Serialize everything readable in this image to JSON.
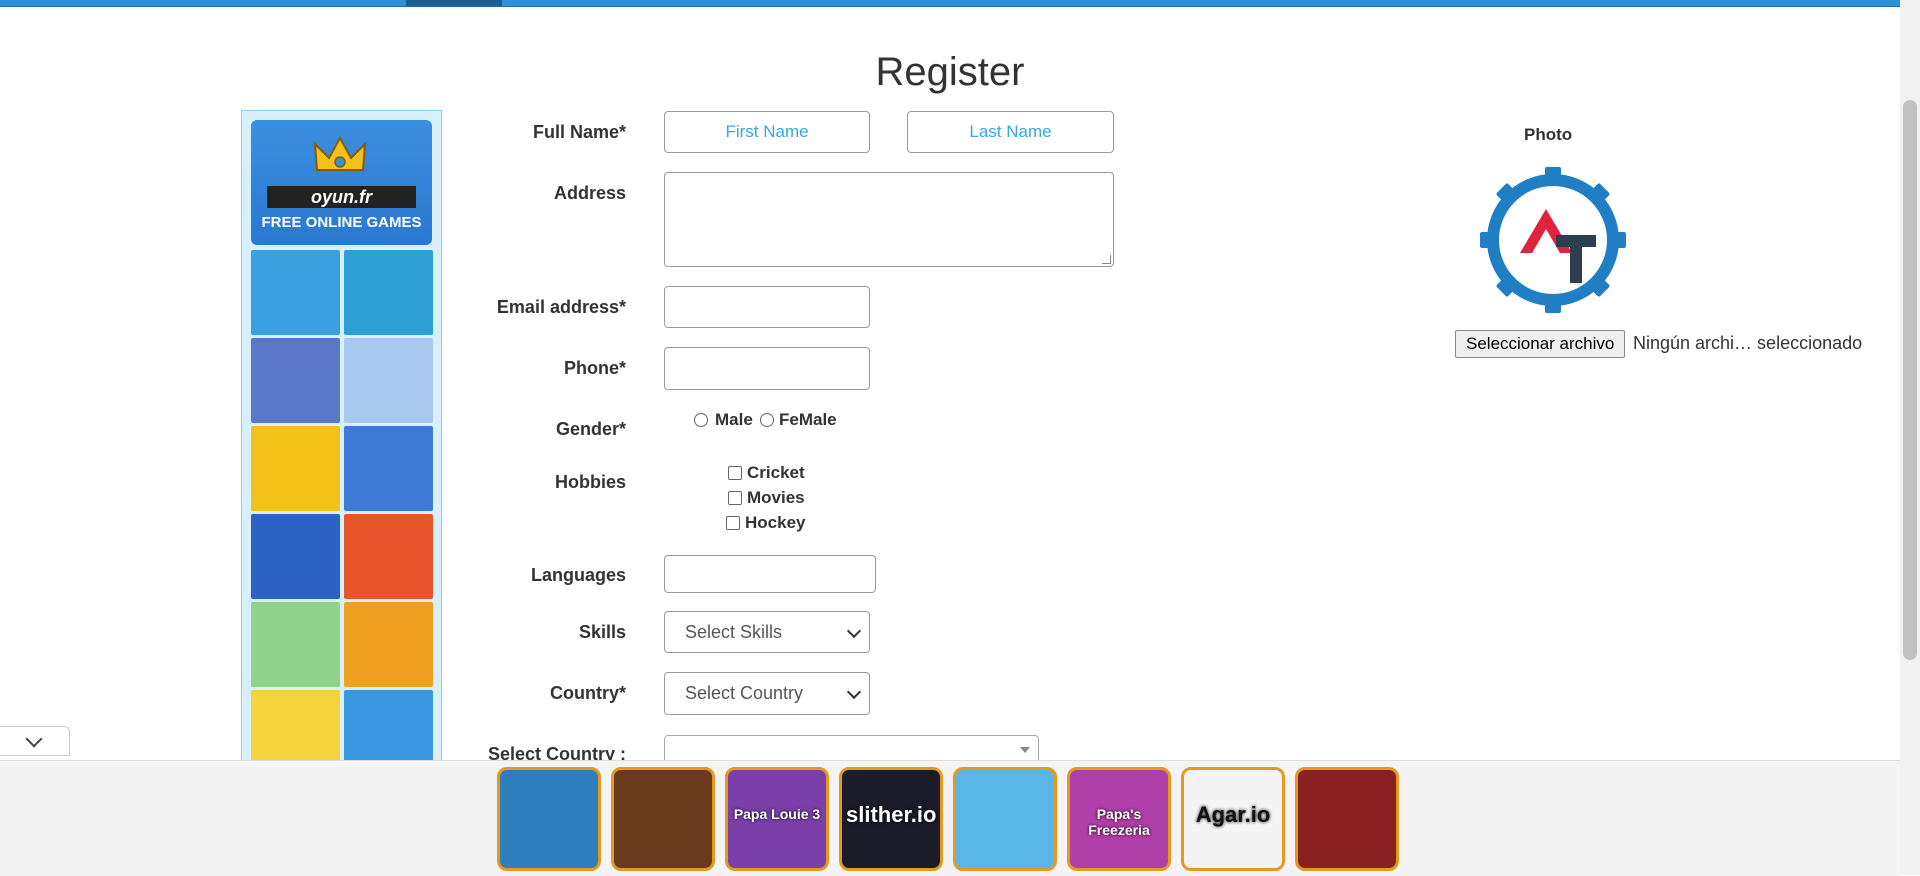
{
  "page": {
    "title": "Register"
  },
  "ad": {
    "brand": "oyun.fr",
    "tagline": "FREE ONLINE GAMES",
    "tiles": [
      {
        "name": "runners-game",
        "color": "#3aa0e0"
      },
      {
        "name": "shark-game",
        "color": "#2c9fd4"
      },
      {
        "name": "agent-game",
        "color": "#5a77c8"
      },
      {
        "name": "shooter-game",
        "color": "#a8c8f0"
      },
      {
        "name": "cuphead-game",
        "color": "#f2c21b"
      },
      {
        "name": "stickman-game",
        "color": "#3d7bd6"
      },
      {
        "name": "sonic-game",
        "color": "#2b62c4"
      },
      {
        "name": "fireboy-game",
        "color": "#e8552a"
      },
      {
        "name": "archer-game",
        "color": "#8fd48a"
      },
      {
        "name": "mario-game",
        "color": "#f0a020"
      },
      {
        "name": "spongebob-game",
        "color": "#f5d33b"
      },
      {
        "name": "stick-war-game",
        "color": "#3a98e0"
      }
    ]
  },
  "form": {
    "full_name_label": "Full Name*",
    "first_name_placeholder": "First Name",
    "last_name_placeholder": "Last Name",
    "address_label": "Address",
    "email_label": "Email address*",
    "phone_label": "Phone*",
    "gender_label": "Gender*",
    "gender_options": [
      "Male",
      "FeMale"
    ],
    "hobbies_label": "Hobbies",
    "hobbies": [
      "Cricket",
      "Movies",
      "Hockey"
    ],
    "languages_label": "Languages",
    "skills_label": "Skills",
    "skills_value": "Select Skills",
    "country_label": "Country*",
    "country_value": "Select Country",
    "select_country_label": "Select Country :"
  },
  "photo": {
    "label": "Photo",
    "file_button": "Seleccionar archivo",
    "file_status": "Ningún archi… seleccionado"
  },
  "colors": {
    "accent": "#2f8fd8",
    "placeholder": "#35a6e8",
    "logo_gear": "#1f7ec4",
    "logo_a": "#e0233d",
    "logo_t": "#2d3e50"
  },
  "bottom_games": [
    {
      "name": "fireboy-watergirl",
      "color": "#2f7fbf",
      "text": ""
    },
    {
      "name": "hero-3",
      "color": "#6b3a1e",
      "text": ""
    },
    {
      "name": "papa-louie-3",
      "color": "#7a3fa8",
      "text": "Papa Louie 3"
    },
    {
      "name": "slither-io",
      "color": "#1b1b2a",
      "text": "slither.io"
    },
    {
      "name": "moto-x3m",
      "color": "#5bb6e8",
      "text": ""
    },
    {
      "name": "papas-freezeria",
      "color": "#b03ea8",
      "text": "Papa's Freezeria"
    },
    {
      "name": "agar-io",
      "color": "#f4f4f4",
      "text": "Agar.io"
    },
    {
      "name": "robot-game",
      "color": "#8a2020",
      "text": ""
    }
  ]
}
